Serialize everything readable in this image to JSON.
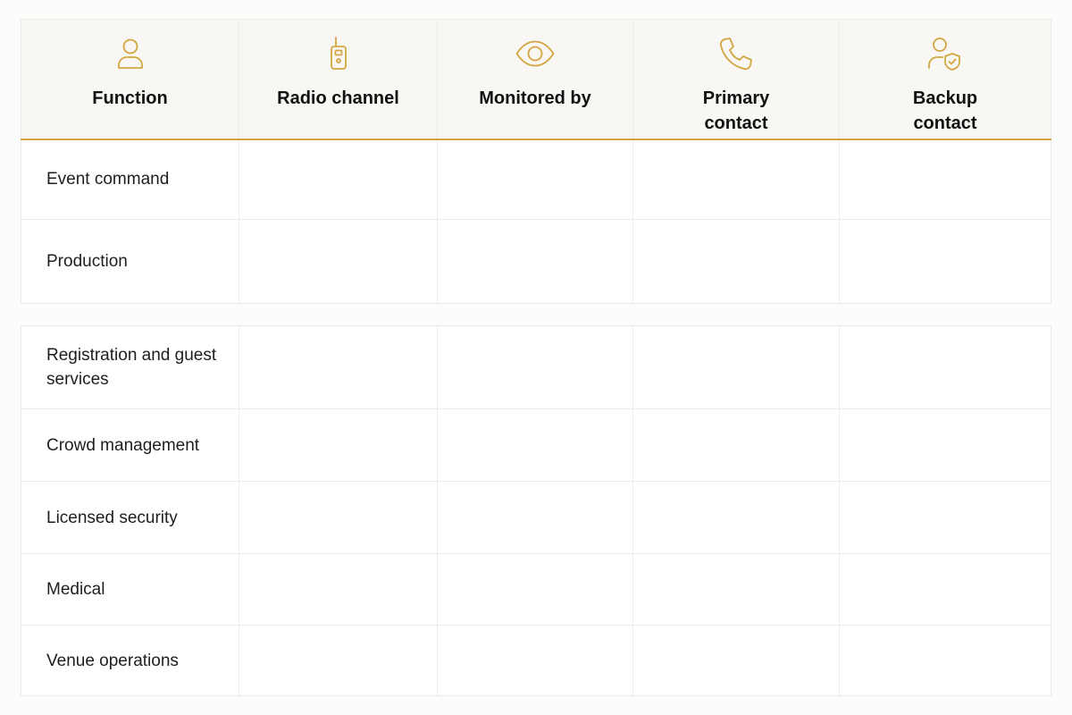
{
  "header": {
    "columns": [
      {
        "label": "Function",
        "icon": "person-icon"
      },
      {
        "label": "Radio channel",
        "icon": "walkie-talkie-icon"
      },
      {
        "label": "Monitored by",
        "icon": "eye-icon"
      },
      {
        "label": "Primary contact",
        "icon": "phone-icon"
      },
      {
        "label": "Backup contact",
        "icon": "person-shield-icon"
      }
    ]
  },
  "groups": [
    {
      "rows": [
        {
          "function": "Event command",
          "radio_channel": "",
          "monitored_by": "",
          "primary_contact": "",
          "backup_contact": ""
        },
        {
          "function": "Production",
          "radio_channel": "",
          "monitored_by": "",
          "primary_contact": "",
          "backup_contact": ""
        }
      ]
    },
    {
      "rows": [
        {
          "function": "Registration and guest services",
          "radio_channel": "",
          "monitored_by": "",
          "primary_contact": "",
          "backup_contact": ""
        },
        {
          "function": "Crowd management",
          "radio_channel": "",
          "monitored_by": "",
          "primary_contact": "",
          "backup_contact": ""
        },
        {
          "function": "Licensed security",
          "radio_channel": "",
          "monitored_by": "",
          "primary_contact": "",
          "backup_contact": ""
        },
        {
          "function": "Medical",
          "radio_channel": "",
          "monitored_by": "",
          "primary_contact": "",
          "backup_contact": ""
        },
        {
          "function": "Venue operations",
          "radio_channel": "",
          "monitored_by": "",
          "primary_contact": "",
          "backup_contact": ""
        }
      ]
    }
  ],
  "colors": {
    "accent": "#d3a640",
    "header_bg": "#f8f7f3",
    "grid_line": "#ebebea"
  }
}
